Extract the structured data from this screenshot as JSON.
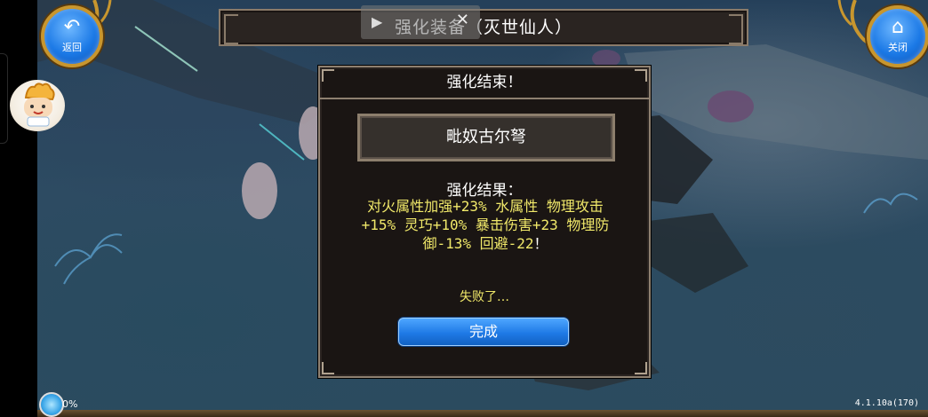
{
  "header": {
    "back_label": "返回",
    "close_label": "关闭",
    "title": "强化装备（灭世仙人）"
  },
  "dialog": {
    "title": "强化结束！",
    "item_name": "毗奴古尔弩",
    "result_label": "强化结果：",
    "result_lines": [
      "对火属性加强+23% 水属性 物理攻击",
      "+15% 灵巧+10% 暴击伤害+23 物理防",
      "御-13% 回避-22"
    ],
    "result_end": "！",
    "fail_text": "失败了…",
    "done_label": "完成"
  },
  "status": {
    "progress_text": "0%",
    "version": "4.1.10a(170)"
  },
  "colors": {
    "result_text": "#f1e96a",
    "button_blue": "#1f7ae6",
    "frame": "#8e8070"
  },
  "icons": [
    "back-arrow-icon",
    "home-icon",
    "play-icon",
    "close-x-icon",
    "mascot-avatar",
    "loading-icon"
  ]
}
